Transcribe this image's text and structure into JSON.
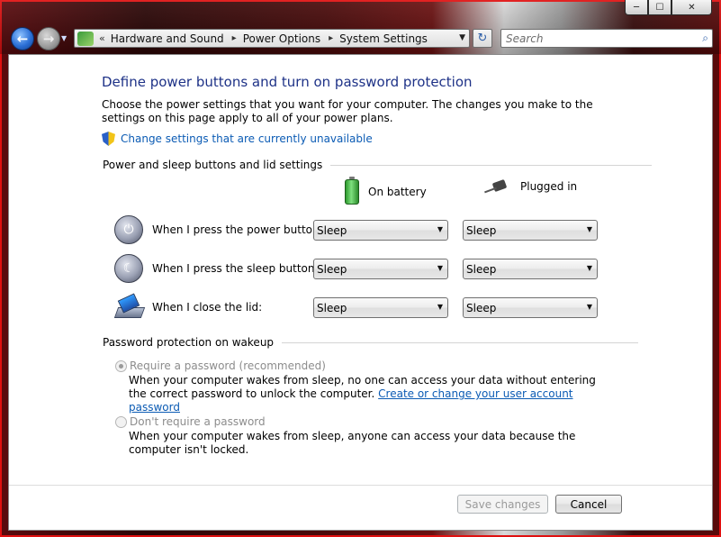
{
  "window": {
    "minimize_glyph": "─",
    "maximize_glyph": "☐",
    "close_glyph": "✕"
  },
  "nav": {
    "back_glyph": "←",
    "forward_glyph": "→",
    "address_chevron": "«",
    "breadcrumbs": [
      "Hardware and Sound",
      "Power Options",
      "System Settings"
    ],
    "breadcrumb_sep": "▸",
    "refresh_glyph": "↻",
    "search_placeholder": "Search",
    "search_glyph": "⌕"
  },
  "page": {
    "title": "Define power buttons and turn on password protection",
    "intro": "Choose the power settings that you want for your computer. The changes you make to the settings on this page apply to all of your power plans.",
    "change_link": "Change settings that are currently unavailable"
  },
  "power_group": {
    "heading": "Power and sleep buttons and lid settings",
    "col_battery": "On battery",
    "col_plugged": "Plugged in",
    "rows": [
      {
        "label": "When I press the power button:",
        "battery": "Sleep",
        "plugged": "Sleep"
      },
      {
        "label": "When I press the sleep button:",
        "battery": "Sleep",
        "plugged": "Sleep"
      },
      {
        "label": "When I close the lid:",
        "battery": "Sleep",
        "plugged": "Sleep"
      }
    ]
  },
  "password_group": {
    "heading": "Password protection on wakeup",
    "require_label": "Require a password (recommended)",
    "require_desc": "When your computer wakes from sleep, no one can access your data without entering the correct password to unlock the computer.",
    "require_link": "Create or change your user account password",
    "no_require_label": "Don't require a password",
    "no_require_desc": "When your computer wakes from sleep, anyone can access your data because the computer isn't locked."
  },
  "footer": {
    "save_label": "Save changes",
    "cancel_label": "Cancel"
  },
  "dropdown_arrow": "▼"
}
